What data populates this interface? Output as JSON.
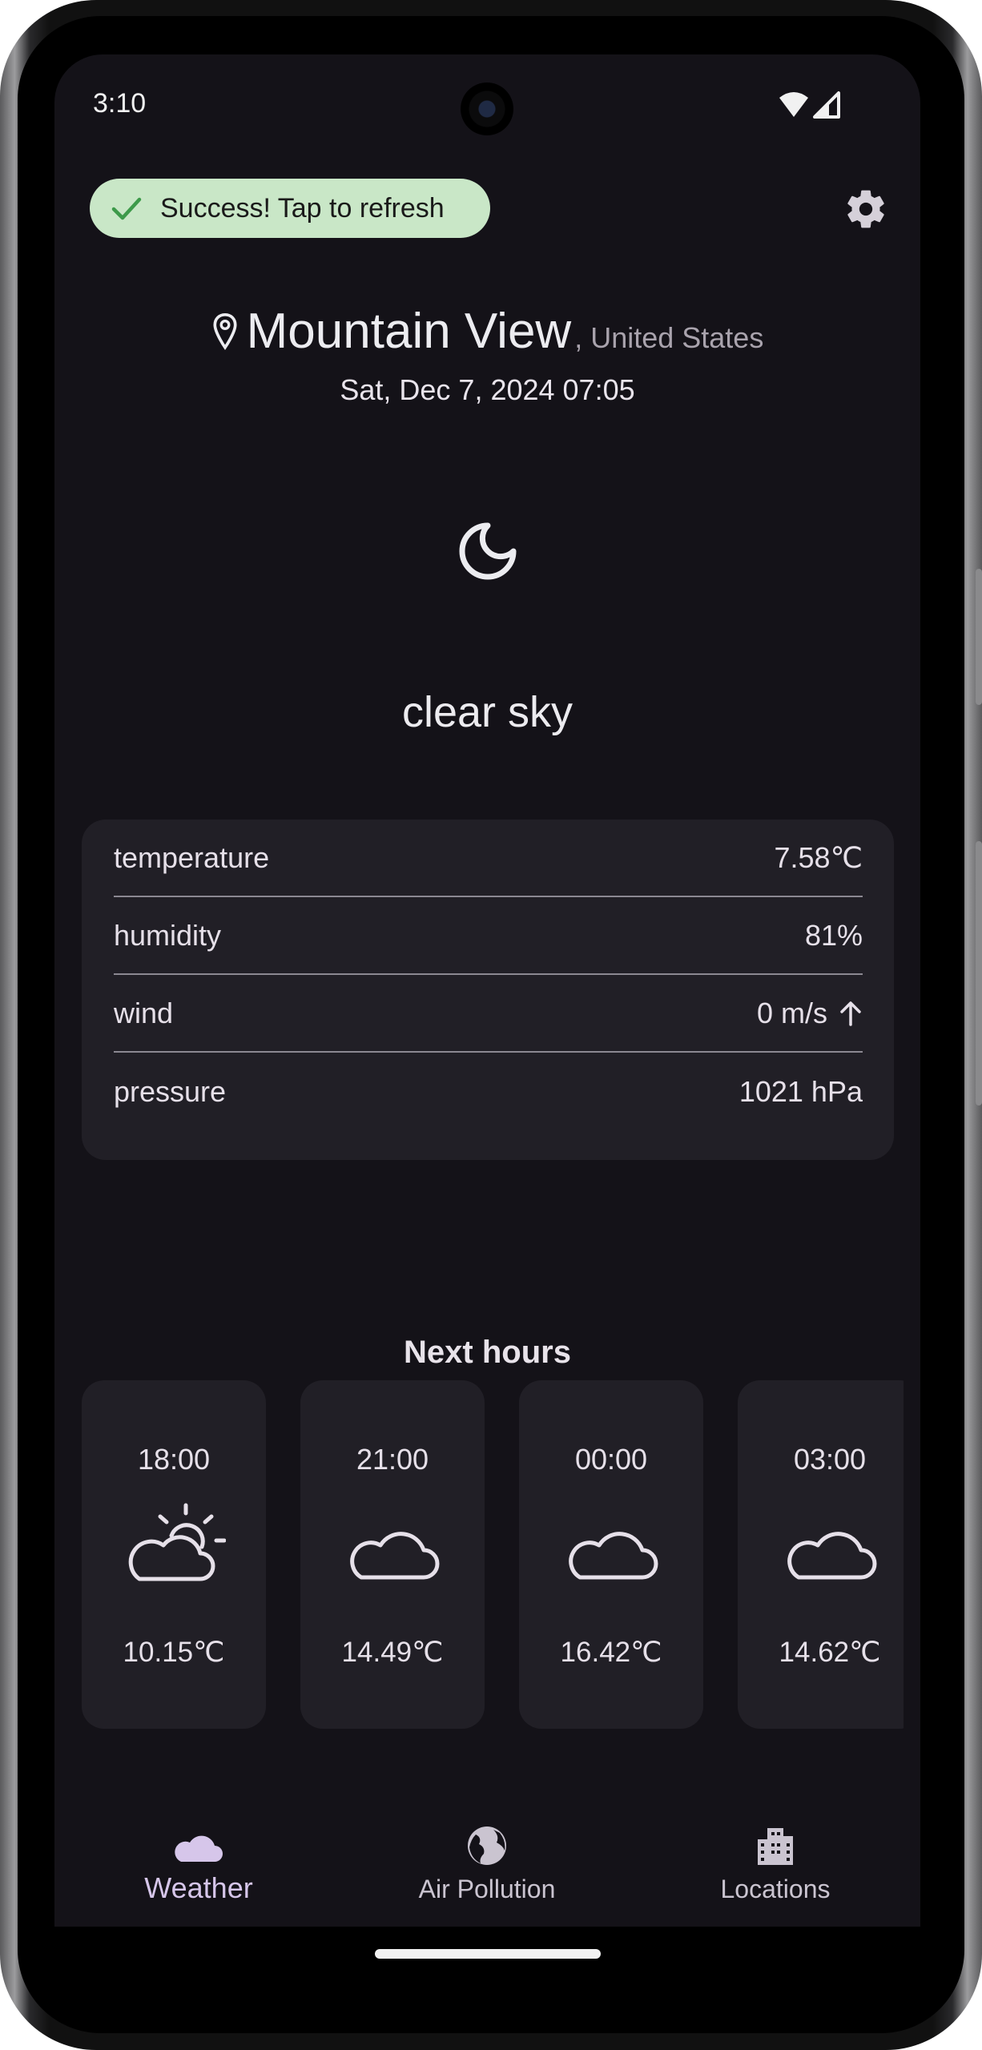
{
  "status_bar": {
    "time": "3:10"
  },
  "toast": {
    "label": "Success! Tap to refresh"
  },
  "location": {
    "city": "Mountain View",
    "country": ", United States",
    "datetime": "Sat, Dec 7, 2024 07:05"
  },
  "current": {
    "condition": "clear sky",
    "details": [
      {
        "label": "temperature",
        "value": "7.58℃"
      },
      {
        "label": "humidity",
        "value": "81%"
      },
      {
        "label": "wind",
        "value": "0 m/s"
      },
      {
        "label": "pressure",
        "value": "1021 hPa"
      }
    ]
  },
  "forecast": {
    "title": "Next hours",
    "items": [
      {
        "time": "18:00",
        "icon": "partly-cloudy-day-icon",
        "temp": "10.15℃"
      },
      {
        "time": "21:00",
        "icon": "cloud-icon",
        "temp": "14.49℃"
      },
      {
        "time": "00:00",
        "icon": "cloud-icon",
        "temp": "16.42℃"
      },
      {
        "time": "03:00",
        "icon": "cloud-icon",
        "temp": "14.62℃"
      }
    ]
  },
  "nav": [
    {
      "label": "Weather",
      "icon": "cloud-icon",
      "active": true
    },
    {
      "label": "Air Pollution",
      "icon": "globe-icon",
      "active": false
    },
    {
      "label": "Locations",
      "icon": "buildings-icon",
      "active": false
    }
  ],
  "colors": {
    "background": "#141218",
    "surface": "#211f26",
    "chip": "#c9e7c7",
    "accent": "#d6c6ea"
  }
}
